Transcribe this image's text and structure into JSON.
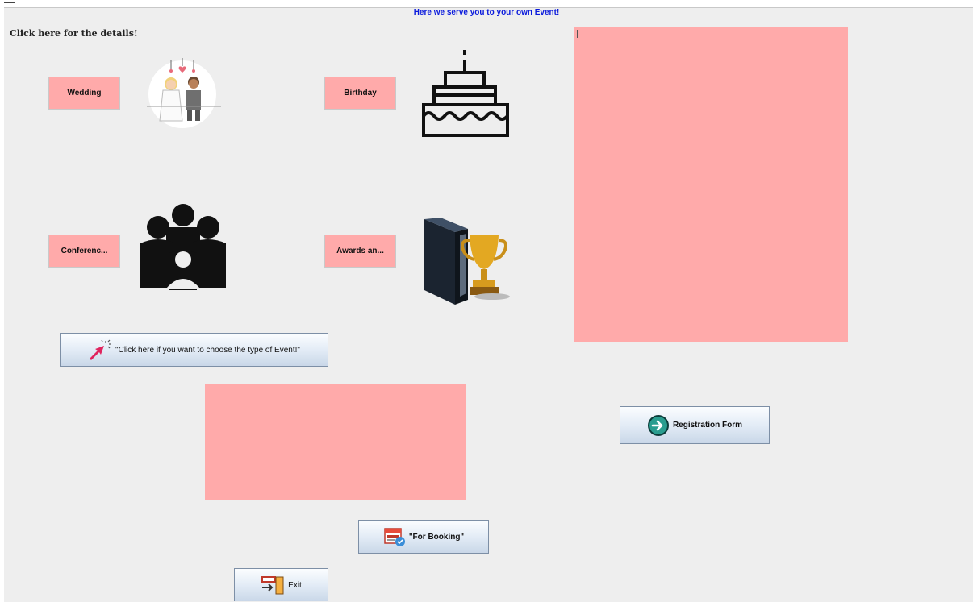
{
  "header": {
    "title": "Here we serve you to your own Event!"
  },
  "details_label": "Click here for the details!",
  "events": {
    "wedding": {
      "label": "Wedding",
      "icon": "wedding-couple-icon"
    },
    "birthday": {
      "label": "Birthday",
      "icon": "birthday-cake-icon"
    },
    "conference": {
      "label": "Conferenc...",
      "icon": "conference-people-icon"
    },
    "awards": {
      "label": "Awards an...",
      "icon": "trophy-icon"
    }
  },
  "choose_button": {
    "label": "\"Click here if you want to choose the type of Event!\"",
    "icon": "cursor-click-icon"
  },
  "registration_button": {
    "label": "Registration Form",
    "icon": "arrow-right-circle-icon"
  },
  "booking_button": {
    "label": "\"For Booking\"",
    "icon": "calendar-booking-icon"
  },
  "exit_button": {
    "label": "Exit",
    "icon": "exit-door-icon"
  },
  "colors": {
    "pink": "#ffaaaa",
    "header_blue": "#0a1adc",
    "background": "#eeeeee"
  }
}
